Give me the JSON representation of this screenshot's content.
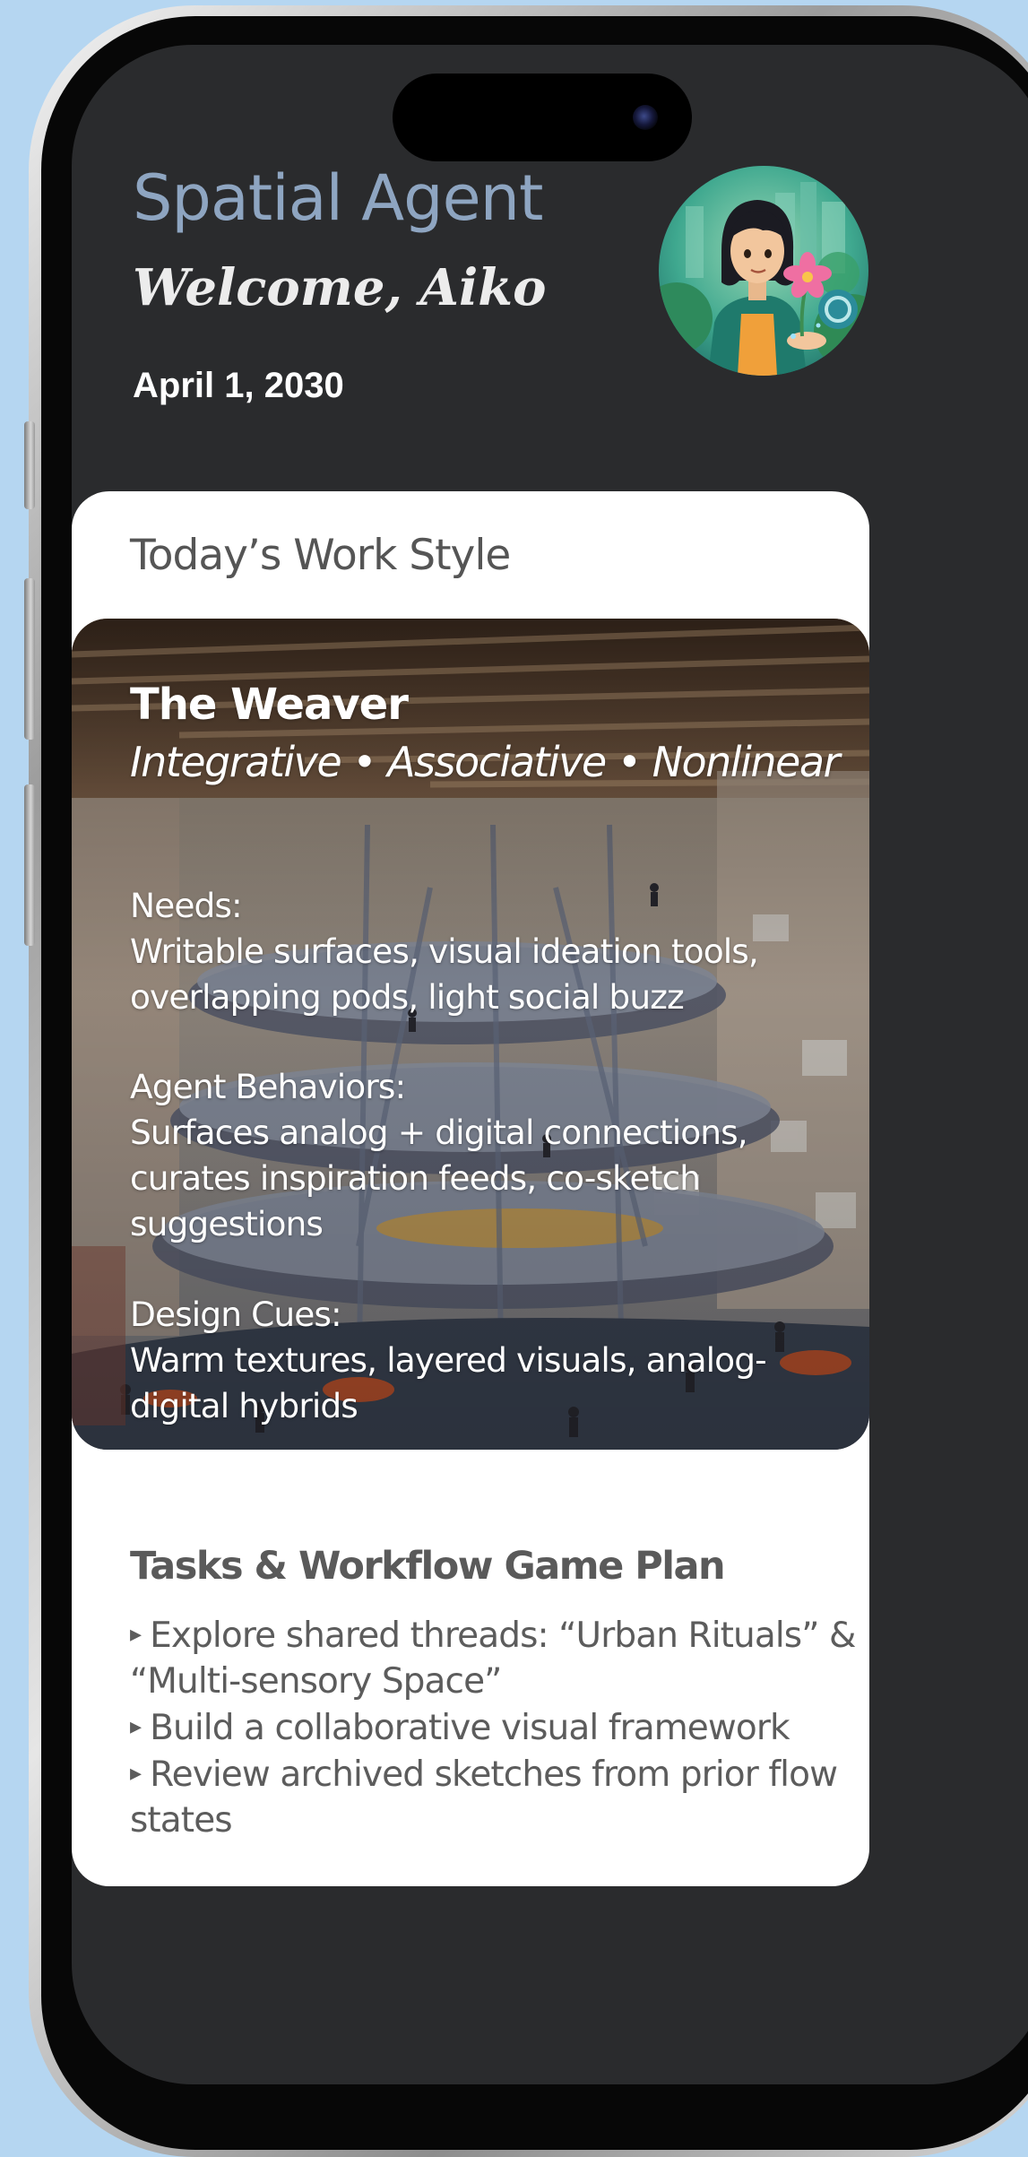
{
  "header": {
    "app_title": "Spatial Agent",
    "welcome": "Welcome, Aiko",
    "date": "April 1, 2030"
  },
  "work_style": {
    "heading": "Today’s Work Style",
    "name": "The Weaver",
    "traits": "Integrative • Associative • Nonlinear",
    "needs_label": "Needs:",
    "needs_lines": [
      "Writable surfaces, visual ideation tools,",
      "overlapping pods, light social buzz"
    ],
    "behaviors_label": "Agent Behaviors:",
    "behaviors_lines": [
      "Surfaces analog + digital connections,",
      "curates inspiration feeds, co-sketch",
      "suggestions"
    ],
    "cues_label": "Design Cues:",
    "cues_lines": [
      "Warm textures, layered visuals, analog-",
      "digital hybrids"
    ]
  },
  "tasks": {
    "heading": "Tasks & Workflow Game Plan",
    "bullet_glyph": "▸",
    "items": [
      {
        "lines": [
          "Explore shared threads: “Urban Rituals” &",
          "“Multi-sensory Space”"
        ]
      },
      {
        "lines": [
          "Build a collaborative visual framework"
        ]
      },
      {
        "lines": [
          "Review archived sketches from prior flow",
          "states"
        ]
      }
    ]
  },
  "colors": {
    "page_background": "#b5d6f1",
    "screen_background": "#2a2b2d",
    "title_accent": "#8ea5c1",
    "card_background": "#ffffff",
    "card_text": "#5c5c5c"
  },
  "icons": {
    "avatar": "user-avatar-illustration",
    "camera": "front-camera-icon",
    "bullet": "triangle-bullet-icon"
  }
}
